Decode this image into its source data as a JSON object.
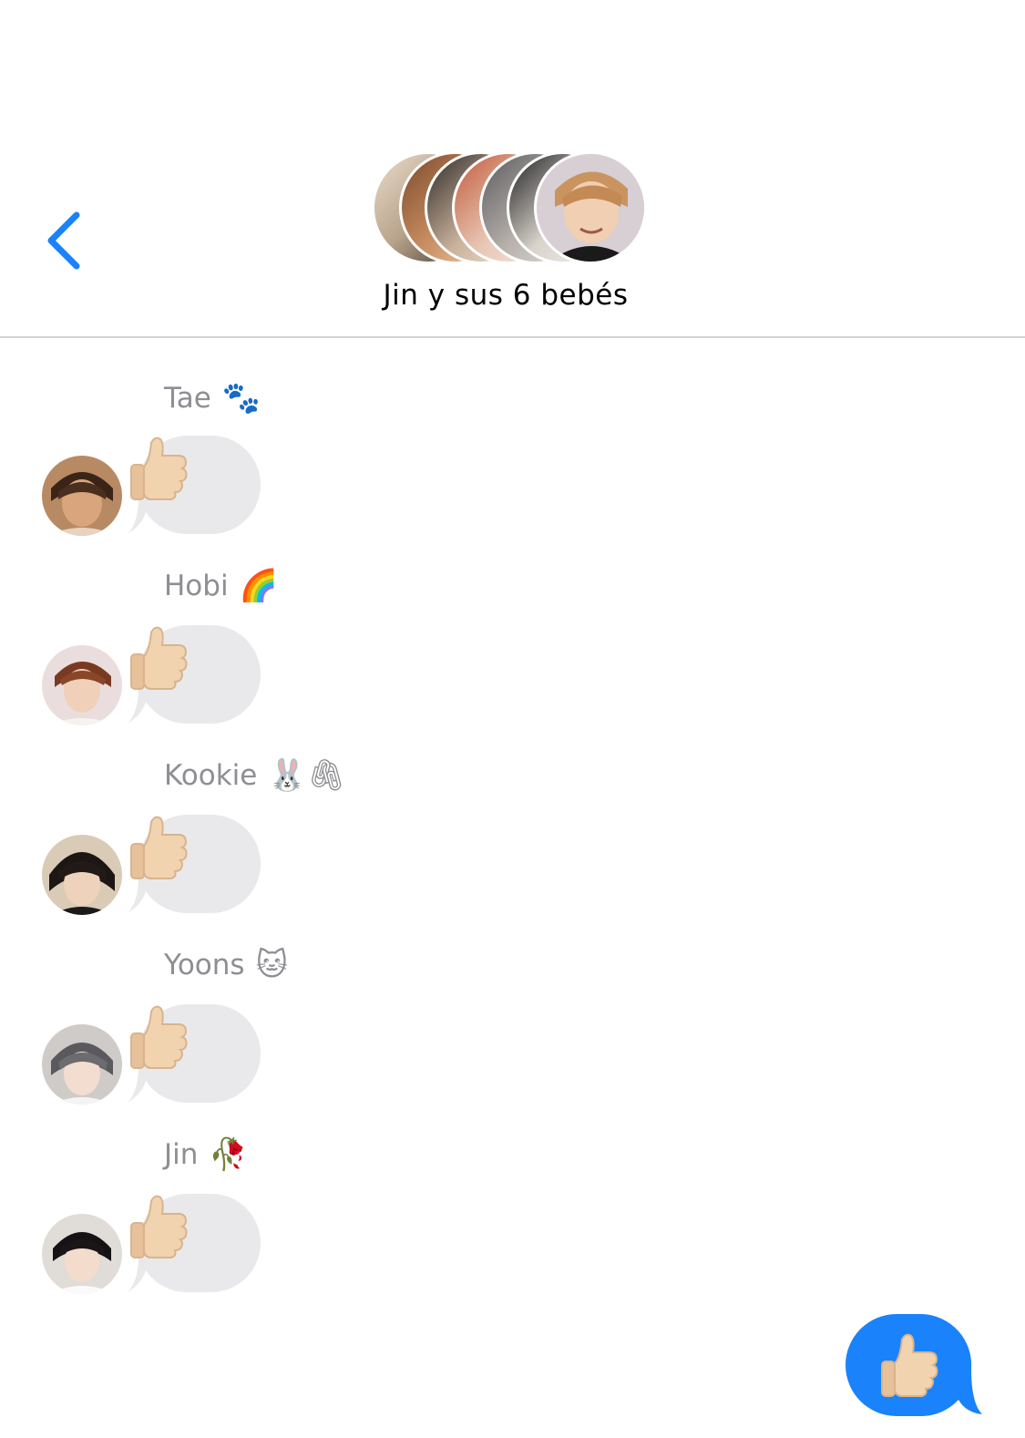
{
  "header": {
    "group_name": "Jin y sus 6 bebés",
    "back_icon": "chevron-left-icon",
    "accent_color": "#1a82fb"
  },
  "messages": [
    {
      "sender": "Tae",
      "sender_emoji": "🐾",
      "content": "👍"
    },
    {
      "sender": "Hobi",
      "sender_emoji": "🌈",
      "content": "👍"
    },
    {
      "sender": "Kookie",
      "sender_emoji": "🐰🖇",
      "content": "👍"
    },
    {
      "sender": "Yoons",
      "sender_emoji": "🐱",
      "content": "👍"
    },
    {
      "sender": "Jin",
      "sender_emoji": "🥀",
      "content": "👍"
    }
  ],
  "outgoing": {
    "content": "👍",
    "bubble_color": "#1a82fb"
  },
  "colors": {
    "incoming_bubble": "#e9e9eb",
    "sender_name": "#8e8e93",
    "divider": "#d1d1d6"
  }
}
